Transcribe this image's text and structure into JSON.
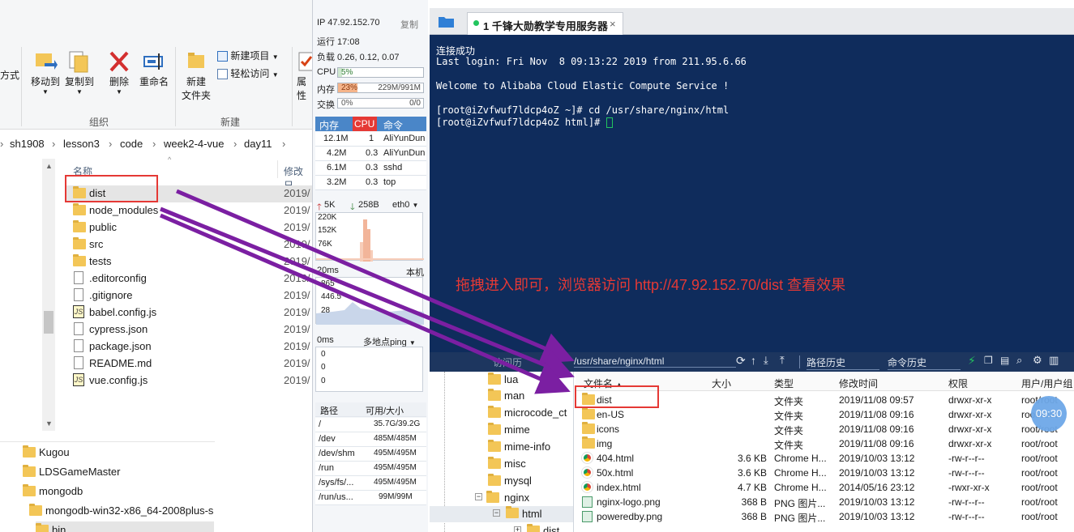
{
  "explorer": {
    "ribbon": {
      "partial_left_label": "方式",
      "move_to": "移动到",
      "copy_to": "复制到",
      "delete": "删除",
      "rename": "重命名",
      "organize_group": "组织",
      "new_folder": "新建\n文件夹",
      "new_item": "新建项目",
      "easy_access": "轻松访问",
      "new_group": "新建",
      "properties_partial": "属性"
    },
    "breadcrumb": [
      "sh1908",
      "lesson3",
      "code",
      "week2-4-vue",
      "day11"
    ],
    "columns": {
      "name": "名称",
      "modified": "修改日"
    },
    "files": [
      {
        "name": "dist",
        "type": "folder",
        "date": "2019/"
      },
      {
        "name": "node_modules",
        "type": "folder",
        "date": "2019/"
      },
      {
        "name": "public",
        "type": "folder",
        "date": "2019/"
      },
      {
        "name": "src",
        "type": "folder",
        "date": "2019/"
      },
      {
        "name": "tests",
        "type": "folder",
        "date": "2019/"
      },
      {
        "name": ".editorconfig",
        "type": "file",
        "date": "2019/"
      },
      {
        "name": ".gitignore",
        "type": "file",
        "date": "2019/"
      },
      {
        "name": "babel.config.js",
        "type": "js",
        "date": "2019/"
      },
      {
        "name": "cypress.json",
        "type": "file",
        "date": "2019/"
      },
      {
        "name": "package.json",
        "type": "file",
        "date": "2019/"
      },
      {
        "name": "README.md",
        "type": "md",
        "date": "2019/"
      },
      {
        "name": "vue.config.js",
        "type": "js",
        "date": "2019/"
      }
    ],
    "nav_tree": [
      "Kugou",
      "LDSGameMaster",
      "mongodb",
      "mongodb-win32-x86_64-2008plus-s",
      "bin"
    ]
  },
  "status": {
    "ip": "IP 47.92.152.70",
    "copy": "复制",
    "uptime": "运行 17:08",
    "load": "负载 0.26, 0.12, 0.07",
    "cpu_label": "CPU",
    "cpu_pct": "5%",
    "mem_label": "内存",
    "mem_pct": "23%",
    "mem_amt": "229M/991M",
    "swap_label": "交换",
    "swap_pct": "0%",
    "swap_amt": "0/0",
    "proc_headers": [
      "内存",
      "CPU",
      "命令"
    ],
    "processes": [
      {
        "mem": "12.1M",
        "cpu": "1",
        "cmd": "AliYunDun"
      },
      {
        "mem": "4.2M",
        "cpu": "0.3",
        "cmd": "AliYunDun"
      },
      {
        "mem": "6.1M",
        "cpu": "0.3",
        "cmd": "sshd"
      },
      {
        "mem": "3.2M",
        "cpu": "0.3",
        "cmd": "top"
      }
    ],
    "net_up": "5K",
    "net_down": "258B",
    "net_if": "eth0",
    "net_ticks": [
      "220K",
      "152K",
      "76K"
    ],
    "latency_label": "20ms",
    "latency_host": "本机",
    "latency_ticks": [
      "865",
      "446.5",
      "28"
    ],
    "ping_ms": "0ms",
    "ping_label": "多地点ping",
    "ping_ticks": [
      "0",
      "0",
      "0"
    ],
    "disk_headers": [
      "路径",
      "可用/大小"
    ],
    "disks": [
      {
        "path": "/",
        "size": "35.7G/39.2G"
      },
      {
        "path": "/dev",
        "size": "485M/485M"
      },
      {
        "path": "/dev/shm",
        "size": "495M/495M"
      },
      {
        "path": "/run",
        "size": "495M/495M"
      },
      {
        "path": "/sys/fs/...",
        "size": "495M/495M"
      },
      {
        "path": "/run/us...",
        "size": "99M/99M"
      }
    ]
  },
  "terminal": {
    "tab_title": "1 千锋大勋教学专用服务器",
    "lines": [
      "连接成功",
      "Last login: Fri Nov  8 09:13:22 2019 from 211.95.6.66",
      "",
      "Welcome to Alibaba Cloud Elastic Compute Service !",
      "",
      "[root@iZvfwuf7ldcp4oZ ~]# cd /usr/share/nginx/html",
      "[root@iZvfwuf7ldcp4oZ html]# "
    ],
    "annotation": "拖拽进入即可，浏览器访问 http://47.92.152.70/dist 查看效果"
  },
  "sftp": {
    "tree_partial": "访问历",
    "path": "/usr/share/nginx/html",
    "path_history": "路径历史",
    "cmd_history": "命令历史",
    "tree": [
      {
        "name": "lua",
        "indent": 1
      },
      {
        "name": "man",
        "indent": 1
      },
      {
        "name": "microcode_ct",
        "indent": 1
      },
      {
        "name": "mime",
        "indent": 1
      },
      {
        "name": "mime-info",
        "indent": 1
      },
      {
        "name": "misc",
        "indent": 1
      },
      {
        "name": "mysql",
        "indent": 1
      },
      {
        "name": "nginx",
        "indent": 0
      },
      {
        "name": "html",
        "indent": 2
      },
      {
        "name": "dist",
        "indent": 3
      }
    ],
    "columns": [
      "文件名",
      "大小",
      "类型",
      "修改时间",
      "权限",
      "用户/用户组"
    ],
    "files": [
      {
        "name": "dist",
        "size": "",
        "type": "文件夹",
        "mtime": "2019/11/08 09:57",
        "perm": "drwxr-xr-x",
        "owner": "root/root",
        "icon": "folder"
      },
      {
        "name": "en-US",
        "size": "",
        "type": "文件夹",
        "mtime": "2019/11/08 09:16",
        "perm": "drwxr-xr-x",
        "owner": "root/root",
        "icon": "folder"
      },
      {
        "name": "icons",
        "size": "",
        "type": "文件夹",
        "mtime": "2019/11/08 09:16",
        "perm": "drwxr-xr-x",
        "owner": "root/root",
        "icon": "folder"
      },
      {
        "name": "img",
        "size": "",
        "type": "文件夹",
        "mtime": "2019/11/08 09:16",
        "perm": "drwxr-xr-x",
        "owner": "root/root",
        "icon": "folder"
      },
      {
        "name": "404.html",
        "size": "3.6 KB",
        "type": "Chrome H...",
        "mtime": "2019/10/03 13:12",
        "perm": "-rw-r--r--",
        "owner": "root/root",
        "icon": "chrome"
      },
      {
        "name": "50x.html",
        "size": "3.6 KB",
        "type": "Chrome H...",
        "mtime": "2019/10/03 13:12",
        "perm": "-rw-r--r--",
        "owner": "root/root",
        "icon": "chrome"
      },
      {
        "name": "index.html",
        "size": "4.7 KB",
        "type": "Chrome H...",
        "mtime": "2014/05/16 23:12",
        "perm": "-rwxr-xr-x",
        "owner": "root/root",
        "icon": "chrome"
      },
      {
        "name": "nginx-logo.png",
        "size": "368 B",
        "type": "PNG 图片...",
        "mtime": "2019/10/03 13:12",
        "perm": "-rw-r--r--",
        "owner": "root/root",
        "icon": "png"
      },
      {
        "name": "poweredby.png",
        "size": "368 B",
        "type": "PNG 图片...",
        "mtime": "2019/10/03 13:12",
        "perm": "-rw-r--r--",
        "owner": "root/root",
        "icon": "png"
      }
    ],
    "clock": "09:30"
  },
  "colors": {
    "accent_red": "#e53935",
    "arrow_purple": "#7b1fa2",
    "terminal_bg": "#0f2c5c"
  }
}
